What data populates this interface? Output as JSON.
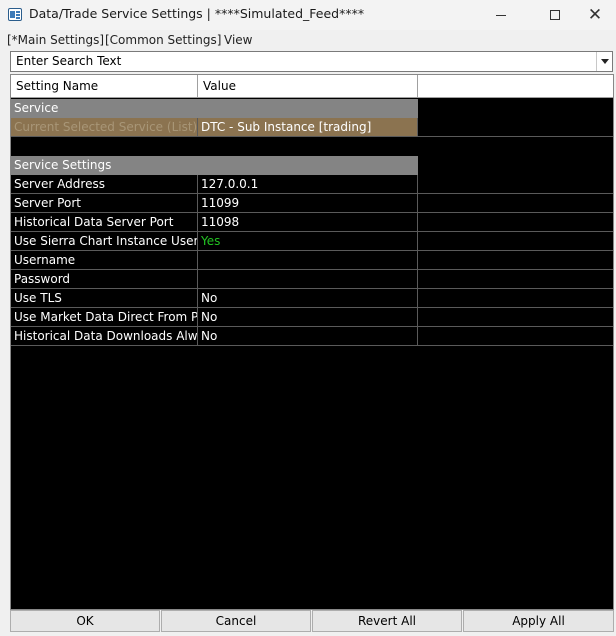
{
  "window": {
    "title": "Data/Trade Service Settings | ****Simulated_Feed****"
  },
  "menu": {
    "main_settings": "[*Main Settings]",
    "common_settings": "[Common Settings]",
    "view": "View"
  },
  "search": {
    "value": "Enter Search Text"
  },
  "grid": {
    "headers": {
      "name": "Setting Name",
      "value": "Value"
    },
    "sections": {
      "service": "Service",
      "service_settings": "Service Settings"
    },
    "selected_row": {
      "name": "Current Selected Service (List) (Read",
      "value": "DTC - Sub Instance    [trading]"
    },
    "rows": [
      {
        "name": "Server Address",
        "value": "127.0.0.1"
      },
      {
        "name": "Server Port",
        "value": "11099"
      },
      {
        "name": "Historical Data Server Port",
        "value": "11098"
      },
      {
        "name": "Use Sierra Chart Instance Username",
        "value": "Yes"
      },
      {
        "name": "Username",
        "value": ""
      },
      {
        "name": "Password",
        "value": ""
      },
      {
        "name": "Use TLS",
        "value": "No"
      },
      {
        "name": "Use Market Data Direct From Primary",
        "value": "No"
      },
      {
        "name": "Historical Data Downloads Always",
        "value": "No"
      }
    ]
  },
  "buttons": {
    "ok": "OK",
    "cancel": "Cancel",
    "revert_all": "Revert All",
    "apply_all": "Apply All"
  },
  "colors": {
    "grid_background": "#000000",
    "section_header": "#848484",
    "selected_row": "#8b7350",
    "yes_value": "#22c322"
  }
}
